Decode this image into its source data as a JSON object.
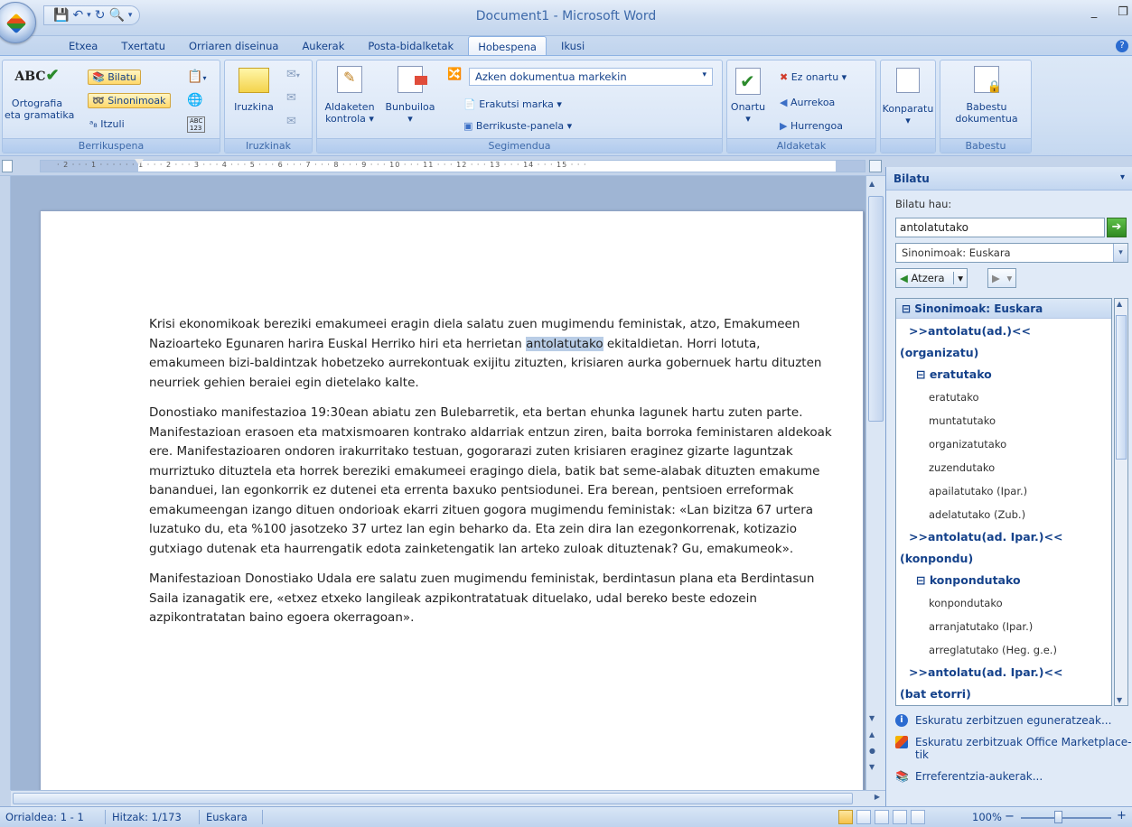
{
  "window": {
    "title": "Document1 - Microsoft Word",
    "min": "_",
    "restore": "❐"
  },
  "tabs": [
    "Etxea",
    "Txertatu",
    "Orriaren diseinua",
    "Aukerak",
    "Posta-bidalketak",
    "Hobespena",
    "Ikusi"
  ],
  "ribbon": {
    "proofing": {
      "spell_top": "Ortografia",
      "spell_bottom": "eta gramatika",
      "search": "Bilatu",
      "synonyms": "Sinonimoak",
      "translate": "Itzuli",
      "abc_top": "ABC",
      "abc_bottom": "123",
      "label": "Berrikuspena"
    },
    "comments": {
      "new": "Iruzkina",
      "label": "Iruzkinak"
    },
    "tracking": {
      "track_top": "Aldaketen",
      "track_bottom": "kontrola ▾",
      "balloons": "Bunbuiloa",
      "balloons_arrow": "▾",
      "display_combo": "Azken dokumentua markekin",
      "show_markup": "Erakutsi marka ▾",
      "review_pane": "Berrikuste-panela ▾",
      "label": "Segimendua"
    },
    "changes": {
      "accept": "Onartu",
      "accept_arrow": "▾",
      "reject": "Ez onartu ▾",
      "previous": "Aurrekoa",
      "next": "Hurrengoa",
      "label": "Aldaketak"
    },
    "compare": {
      "compare": "Konparatu",
      "compare_arrow": "▾",
      "label": ""
    },
    "protect": {
      "top": "Babestu",
      "bottom": "dokumentua",
      "label": "Babestu"
    }
  },
  "document": {
    "p1_before": "Krisi ekonomikoak bereziki emakumeei eragin diela salatu zuen mugimendu feministak, atzo, Emakumeen Nazioarteko Egunaren harira Euskal Herriko hiri eta herrietan ",
    "p1_selected": "antolatutako",
    "p1_after": " ekitaldietan. Horri lotuta, emakumeen bizi-baldintzak hobetzeko aurrekontuak exijitu zituzten, krisiaren aurka gobernuek hartu dituzten neurriek gehien beraiei egin dietelako kalte.",
    "p2": "Donostiako manifestazioa 19:30ean abiatu zen Bulebarretik, eta bertan ehunka lagunek hartu zuten parte. Manifestazioan erasoen eta matxismoaren kontrako aldarriak entzun ziren, baita borroka feministaren aldekoak ere. Manifestazioaren ondoren irakurritako testuan, gogorarazi zuten krisiaren eraginez gizarte laguntzak murriztuko dituztela eta horrek bereziki emakumeei eragingo diela, batik bat seme-alabak dituzten emakume bananduei, lan egonkorrik ez dutenei eta errenta baxuko pentsiodunei. Era berean, pentsioen erreformak emakumeengan izango dituen ondorioak ekarri zituen gogora mugimendu feministak: «Lan bizitza 67 urtera luzatuko du, eta %100 jasotzeko 37 urtez lan egin beharko da. Eta zein dira lan ezegonkorrenak, kotizazio gutxiago dutenak eta haurrengatik edota zainketengatik lan arteko zuloak dituztenak? Gu, emakumeok».",
    "p3": "Manifestazioan Donostiako Udala ere salatu zuen mugimendu feministak, berdintasun plana eta Berdintasun Saila izanagatik ere, «etxez etxeko langileak azpikontratatuak dituelako, udal bereko beste edozein azpikontratatan baino egoera okerragoan»."
  },
  "ruler": {
    "ticks": "· 2 · · · 1 · · ·   · · · 1 · · · 2 · · · 3 · · · 4 · · · 5 · · · 6 · · · 7 · · · 8 · · · 9 · · · 10 · · · 11 · · · 12 · · · 13 · · · 14 · · · 15 · · ·"
  },
  "research_pane": {
    "title": "Bilatu",
    "menu_arrow": "▾",
    "search_for_label": "Bilatu hau:",
    "search_value": "antolatutako",
    "go_arrow": "➔",
    "source": "Sinonimoak: Euskara",
    "source_arrow": "▾",
    "back_btn": "Atzera",
    "back_arrow": "▾",
    "fwd_arrow": "▾",
    "results_header": "⊟ Sinonimoak: Euskara",
    "groups": [
      {
        "main": [
          ">>antolatu(ad.)<<",
          "(organizatu)"
        ],
        "sub": "⊟ eratutako",
        "items": [
          "eratutako",
          "muntatutako",
          "organizatutako",
          "zuzendutako",
          "apailatutako (Ipar.)",
          "adelatutako (Zub.)"
        ]
      },
      {
        "main": [
          ">>antolatu(ad. Ipar.)<<",
          "(konpondu)"
        ],
        "sub": "⊟ konpondutako",
        "items": [
          "konpondutako",
          "arranjatutako (Ipar.)",
          "arreglatutako (Heg. g.e.)"
        ]
      },
      {
        "main": [
          ">>antolatu(ad. Ipar.)<<",
          "(bat etorri)"
        ],
        "sub": "",
        "items": []
      }
    ],
    "links": [
      "Eskuratu zerbitzuen eguneratzeak...",
      "Eskuratu zerbitzuak Office Marketplace-tik",
      "Erreferentzia-aukerak..."
    ]
  },
  "status": {
    "page": "Orrialdea: 1 - 1",
    "words": "Hitzak: 1/173",
    "language": "Euskara",
    "zoom": "100%",
    "zoom_minus": "−",
    "zoom_plus": "+"
  },
  "colors": {
    "accent": "#15428b",
    "selection": "#b9cde6",
    "ribbon": "#dbe7f7"
  }
}
